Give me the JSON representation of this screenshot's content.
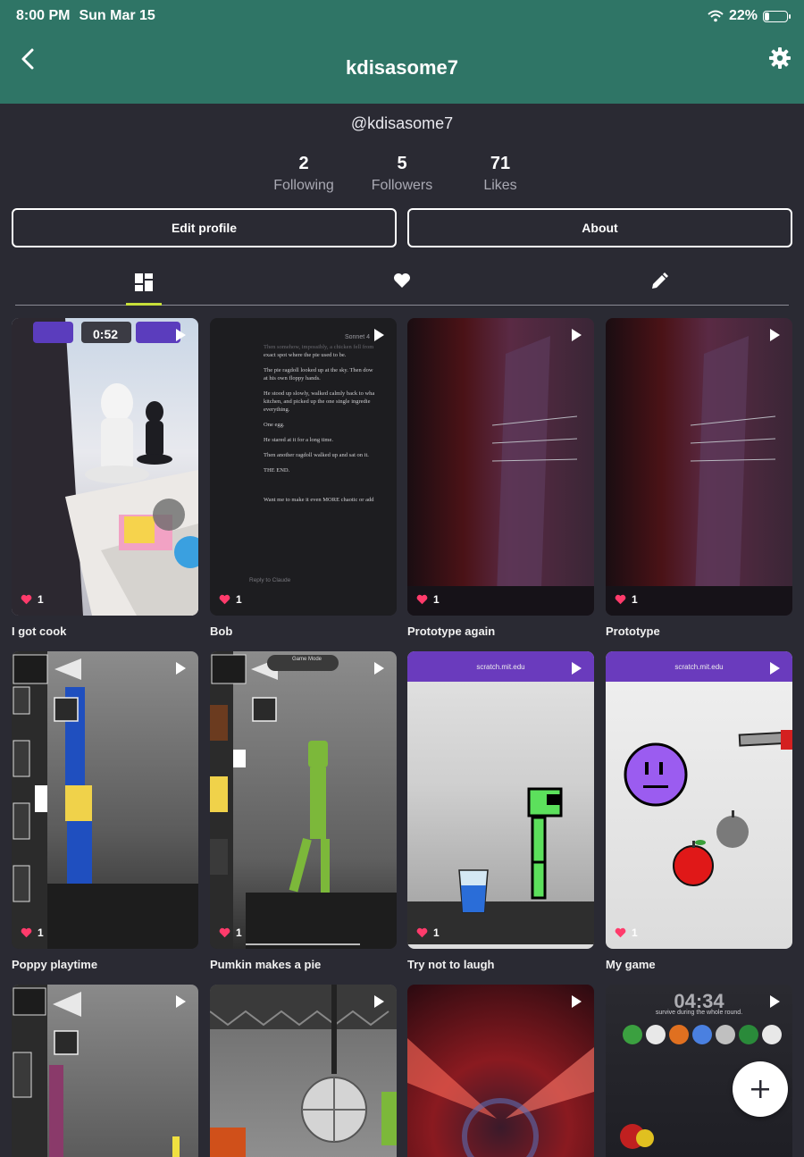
{
  "status_bar": {
    "time": "8:00 PM",
    "date": "Sun Mar 15",
    "battery": "22%",
    "battery_level": 0.22
  },
  "header": {
    "title": "kdisasome7",
    "back_icon": "chevron-left-icon",
    "settings_icon": "gear-icon"
  },
  "profile": {
    "handle": "@kdisasome7",
    "stats": [
      {
        "value": "2",
        "label": "Following"
      },
      {
        "value": "5",
        "label": "Followers"
      },
      {
        "value": "71",
        "label": "Likes"
      }
    ],
    "edit_button": "Edit profile",
    "about_button": "About"
  },
  "tabs": [
    {
      "icon": "grid-icon",
      "active": true
    },
    {
      "icon": "heart-icon",
      "active": false
    },
    {
      "icon": "pencil-icon",
      "active": false
    }
  ],
  "posts": [
    {
      "caption": "I got cook",
      "likes": "1"
    },
    {
      "caption": "Bob",
      "likes": "1"
    },
    {
      "caption": "Prototype again",
      "likes": "1"
    },
    {
      "caption": "Prototype",
      "likes": "1"
    },
    {
      "caption": "Poppy playtime",
      "likes": "1"
    },
    {
      "caption": "Pumkin makes a pie",
      "likes": "1"
    },
    {
      "caption": "Try not to laugh",
      "likes": "1"
    },
    {
      "caption": "My game",
      "likes": "1"
    },
    {
      "caption": "",
      "likes": ""
    },
    {
      "caption": "",
      "likes": ""
    },
    {
      "caption": "",
      "likes": ""
    },
    {
      "caption": "",
      "likes": ""
    }
  ],
  "thumb_text": {
    "game_timer": "0:52",
    "sonnet": "Sonnet 4",
    "story_lines": [
      "Then somehow, impossibly, a chicken fell from",
      "exact spot where the pie used to be.",
      "The pie ragdoll looked up at the sky. Then dow",
      "at his own floppy hands.",
      "He stood up slowly, walked calmly back to wha",
      "kitchen, and picked up the one single ingredie",
      "everything.",
      "One egg.",
      "He stared at it for a long time.",
      "Then another ragdoll walked up and sat on it.",
      "THE END.",
      "Want me to make it even MORE chaotic or add"
    ],
    "reply_hint": "Reply to Claude",
    "scratch_url": "scratch.mit.edu",
    "game_mode": "Game Mode",
    "countdown": "04:34",
    "survive": "survive during the whole round."
  },
  "fab_icon": "plus-icon",
  "colors": {
    "header": "#2f7566",
    "background": "#2a2a33",
    "tab_indicator": "#c8e03a",
    "like_heart": "#ff3b6b"
  }
}
